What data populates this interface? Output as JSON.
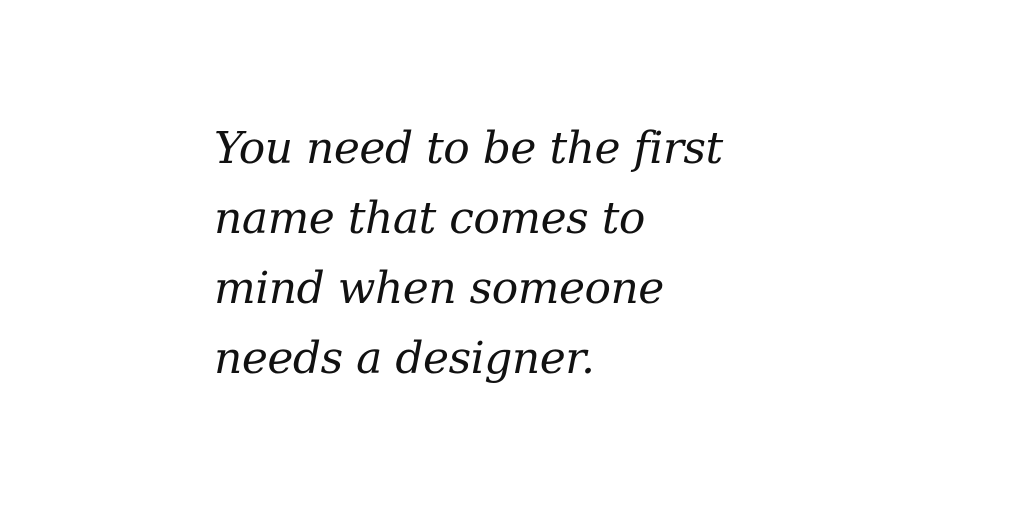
{
  "quote": {
    "lines": [
      "You need to be the first",
      "name that comes to",
      "mind when someone",
      "needs a designer."
    ]
  }
}
